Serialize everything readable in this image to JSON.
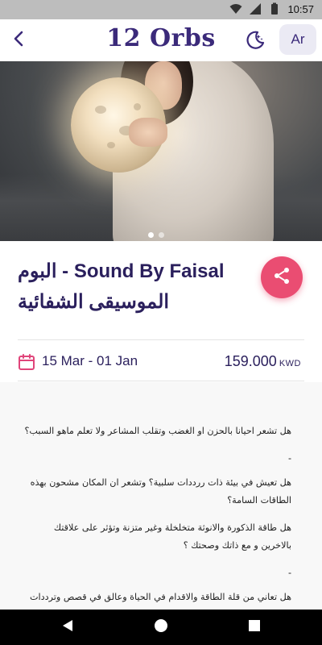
{
  "status_bar": {
    "time": "10:57",
    "icons": [
      "wifi-icon",
      "signal-icon",
      "battery-icon"
    ]
  },
  "header": {
    "title": "12 Orbs",
    "language_button": "Ar",
    "icons": [
      "back-arrow-icon",
      "moon-stars-icon"
    ]
  },
  "hero": {
    "image": "woman holding glowing moon orb",
    "carousel_dots": 2,
    "active_dot": 1
  },
  "product": {
    "title_line1": "Sound By Faisal - البوم",
    "title_line2": "الموسيقى الشفائية",
    "share_icon": "share-icon",
    "dates": "15 Mar - 01 Jan",
    "price": "159.000",
    "currency": "KWD"
  },
  "description": {
    "paragraphs": [
      "هل تشعر احيانا بالحزن او الغضب وتقلب المشاعر ولا تعلم ماهو السبب؟",
      "-",
      "هل تعيش في بيئة ذات ررددات سلبية؟ وتشعر ان المكان مشحون بهذه الطاقات السامة؟",
      "هل طاقة الذكورة والانوثة متخلخلة وغير متزنة وتؤثر على علاقتك بالاخرين و مع ذاتك وصحتك ؟",
      "-",
      "هل تعاني من قلة الطاقة والاقدام في الحياة وعالق في قصص وترددات"
    ]
  },
  "colors": {
    "primary": "#3b2a7a",
    "accent_pink": "#ea4d72",
    "calendar_icon": "#e0457a"
  },
  "nav_bar": {
    "icons": [
      "back-triangle-icon",
      "home-circle-icon",
      "recents-square-icon"
    ]
  }
}
